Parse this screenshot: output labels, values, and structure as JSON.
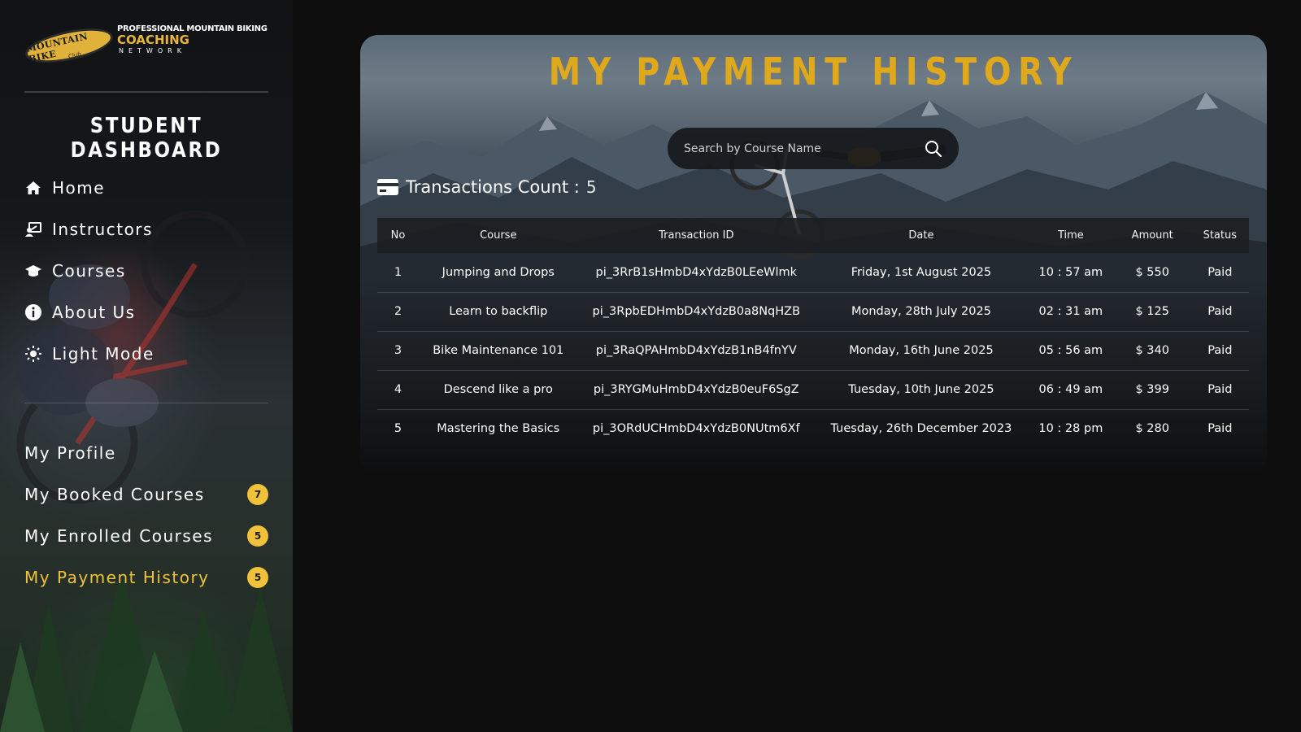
{
  "brand": {
    "badge_text": "MOUNTAIN BIKE",
    "badge_sub": "Club",
    "line1": "PROFESSIONAL MOUNTAIN BIKING",
    "line2": "COACHING",
    "line3": "NETWORK",
    "accent_color": "#e0a91c"
  },
  "sidebar": {
    "title": "STUDENT DASHBOARD",
    "primary_nav": [
      {
        "label": "Home",
        "icon": "home-icon"
      },
      {
        "label": "Instructors",
        "icon": "instructor-icon"
      },
      {
        "label": "Courses",
        "icon": "graduation-cap-icon"
      },
      {
        "label": "About Us",
        "icon": "info-icon"
      },
      {
        "label": "Light Mode",
        "icon": "sun-icon"
      }
    ],
    "secondary_nav": [
      {
        "label": "My Profile",
        "badge": null,
        "active": false
      },
      {
        "label": "My Booked Courses",
        "badge": "7",
        "active": false
      },
      {
        "label": "My Enrolled Courses",
        "badge": "5",
        "active": false
      },
      {
        "label": "My Payment History",
        "badge": "5",
        "active": true
      }
    ]
  },
  "main": {
    "title": "MY PAYMENT HISTORY",
    "search": {
      "placeholder": "Search by Course Name",
      "value": ""
    },
    "transactions_label": "Transactions Count :",
    "transactions_count": "5",
    "table": {
      "columns": [
        "No",
        "Course",
        "Transaction ID",
        "Date",
        "Time",
        "Amount",
        "Status"
      ],
      "rows": [
        {
          "no": "1",
          "course": "Jumping and Drops",
          "tx_id": "pi_3RrB1sHmbD4xYdzB0LEeWlmk",
          "date": "Friday, 1st August 2025",
          "time": "10 : 57 am",
          "amount": "$ 550",
          "status": "Paid"
        },
        {
          "no": "2",
          "course": "Learn to backflip",
          "tx_id": "pi_3RpbEDHmbD4xYdzB0a8NqHZB",
          "date": "Monday, 28th July 2025",
          "time": "02 : 31 am",
          "amount": "$ 125",
          "status": "Paid"
        },
        {
          "no": "3",
          "course": "Bike Maintenance 101",
          "tx_id": "pi_3RaQPAHmbD4xYdzB1nB4fnYV",
          "date": "Monday, 16th June 2025",
          "time": "05 : 56 am",
          "amount": "$ 340",
          "status": "Paid"
        },
        {
          "no": "4",
          "course": "Descend like a pro",
          "tx_id": "pi_3RYGMuHmbD4xYdzB0euF6SgZ",
          "date": "Tuesday, 10th June 2025",
          "time": "06 : 49 am",
          "amount": "$ 399",
          "status": "Paid"
        },
        {
          "no": "5",
          "course": "Mastering the Basics",
          "tx_id": "pi_3ORdUCHmbD4xYdzB0NUtm6Xf",
          "date": "Tuesday, 26th December 2023",
          "time": "10 : 28 pm",
          "amount": "$ 280",
          "status": "Paid"
        }
      ]
    }
  },
  "colors": {
    "accent": "#f0c23a",
    "title": "#e0a91c",
    "background": "#0e0e0f"
  }
}
